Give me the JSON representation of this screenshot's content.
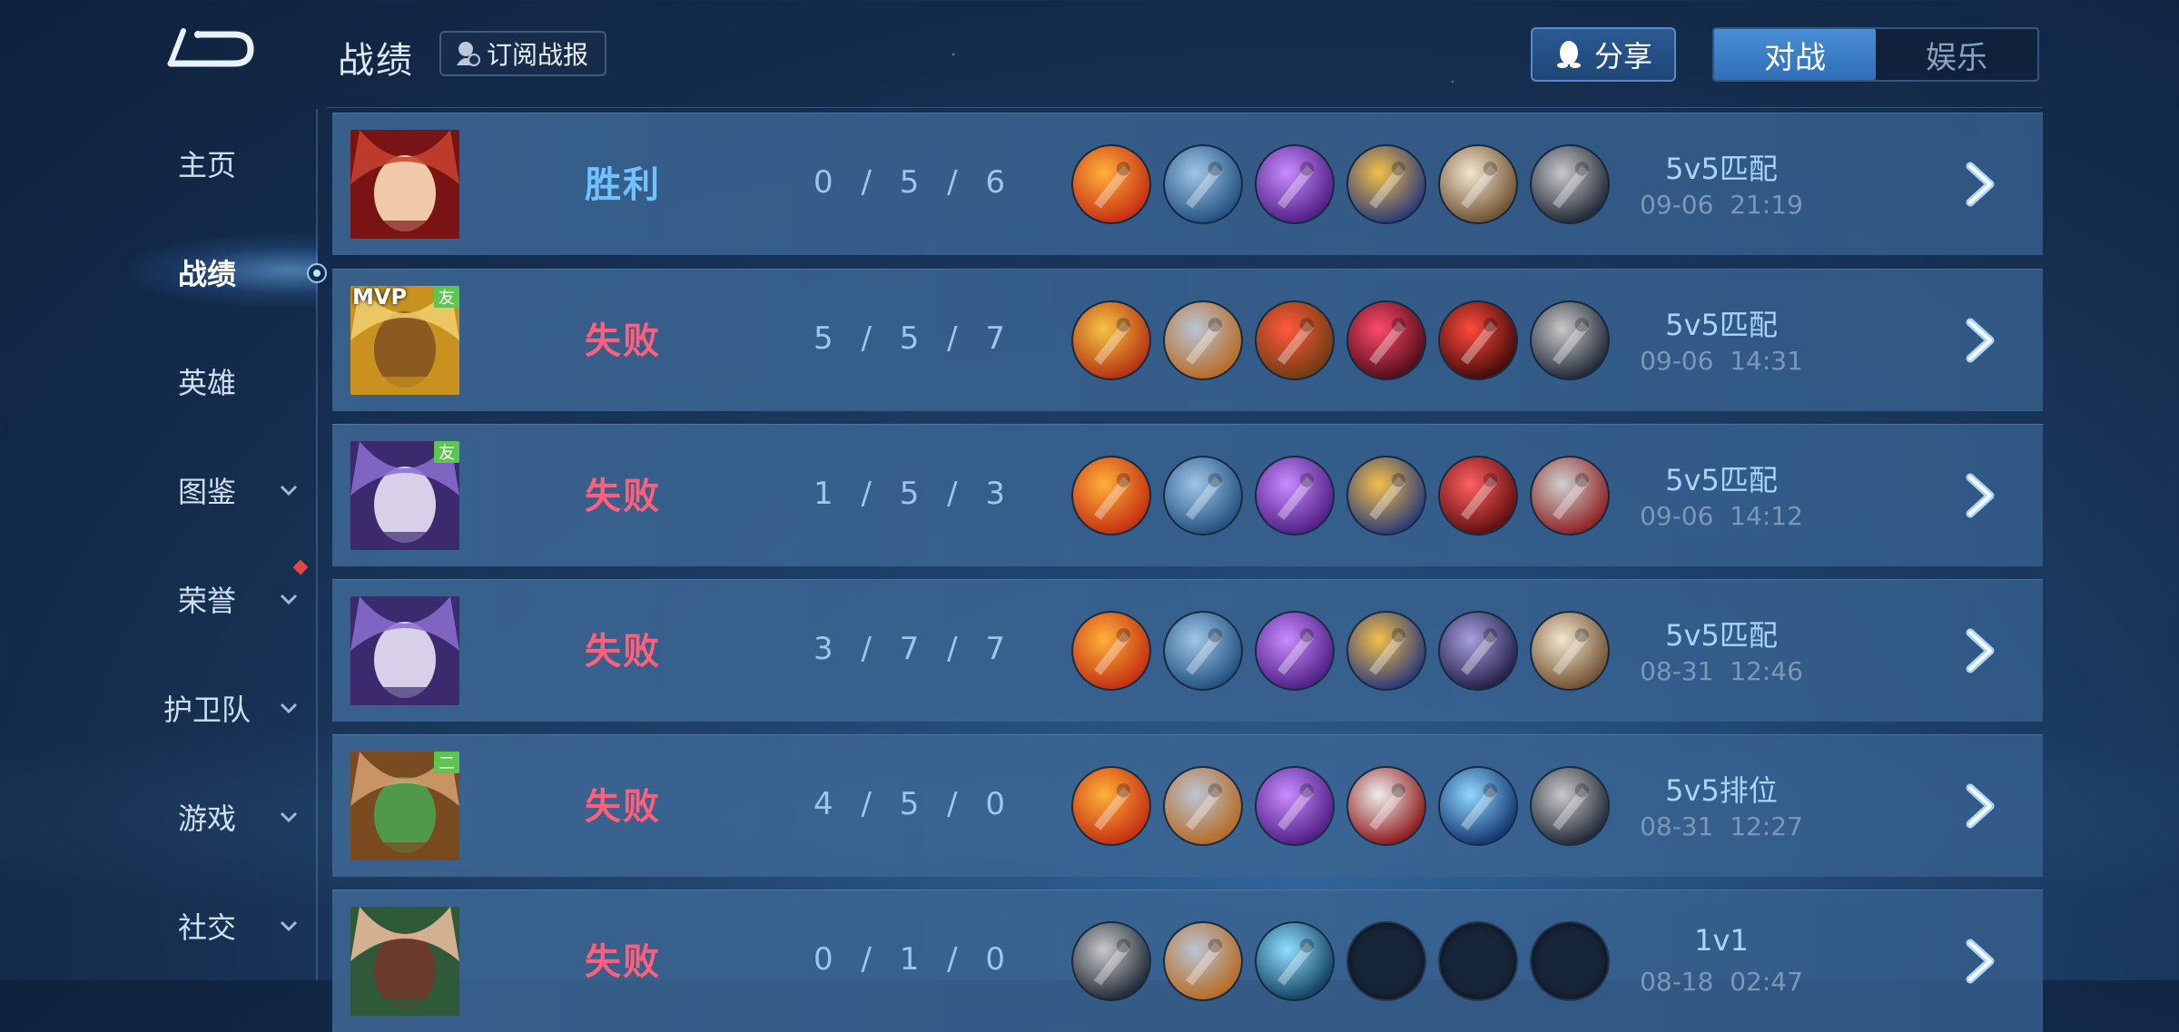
{
  "header": {
    "title": "战绩",
    "subscribe_label": "订阅战报",
    "share_label": "分享",
    "tabs": [
      {
        "label": "对战",
        "active": true
      },
      {
        "label": "娱乐",
        "active": false
      }
    ]
  },
  "sidebar": {
    "items": [
      {
        "label": "主页",
        "has_chevron": false
      },
      {
        "label": "战绩",
        "has_chevron": false,
        "active": true
      },
      {
        "label": "英雄",
        "has_chevron": false
      },
      {
        "label": "图鉴",
        "has_chevron": true
      },
      {
        "label": "荣誉",
        "has_chevron": true,
        "notification": true
      },
      {
        "label": "护卫队",
        "has_chevron": true
      },
      {
        "label": "游戏",
        "has_chevron": true
      },
      {
        "label": "社交",
        "has_chevron": true
      }
    ]
  },
  "matches": [
    {
      "result": "胜利",
      "kda": "0 / 5 / 6",
      "mode": "5v5匹配",
      "time": "09-06  21:19",
      "tag": "",
      "equipment": [
        "boots-flame-icon",
        "frost-boots-icon",
        "purple-axe-icon",
        "gold-star-axe-icon",
        "potion-bag-icon",
        "trident-icon"
      ]
    },
    {
      "result": "失败",
      "kda": "5 / 5 / 7",
      "mode": "5v5匹配",
      "time": "09-06  14:31",
      "tag": "友",
      "mvp": "MVP",
      "equipment": [
        "gold-glove-icon",
        "armored-boots-icon",
        "red-blade-icon",
        "demon-mask-icon",
        "red-helmet-icon",
        "trident-icon"
      ]
    },
    {
      "result": "失败",
      "kda": "1 / 5 / 3",
      "mode": "5v5匹配",
      "time": "09-06  14:12",
      "tag": "友",
      "equipment": [
        "boots-flame-icon",
        "frost-boots-icon",
        "purple-axe-icon",
        "gold-star-axe-icon",
        "red-orb-icon",
        "gauntlet-icon"
      ]
    },
    {
      "result": "失败",
      "kda": "3 / 7 / 7",
      "mode": "5v5匹配",
      "time": "08-31  12:46",
      "tag": "",
      "equipment": [
        "boots-flame-icon",
        "frost-boots-icon",
        "purple-axe-icon",
        "gold-star-axe-icon",
        "dark-armor-icon",
        "potion-bag-icon"
      ]
    },
    {
      "result": "失败",
      "kda": "4 / 5 / 0",
      "mode": "5v5排位",
      "time": "08-31  12:27",
      "tag": "二",
      "equipment": [
        "boots-flame-icon",
        "armored-boots-icon",
        "purple-axe-icon",
        "silver-claw-icon",
        "ice-sword-icon",
        "trident-icon"
      ]
    },
    {
      "result": "失败",
      "kda": "0 / 1 / 0",
      "mode": "1v1",
      "time": "08-18  02:47",
      "tag": "",
      "equipment": [
        "trident-icon",
        "armored-boots-icon",
        "spiral-rune-icon",
        "empty-slot",
        "empty-slot",
        "empty-slot"
      ]
    }
  ],
  "colors": {
    "win": "#6ec3ff",
    "loss": "#ff5f78",
    "accent": "#3f85d2"
  }
}
